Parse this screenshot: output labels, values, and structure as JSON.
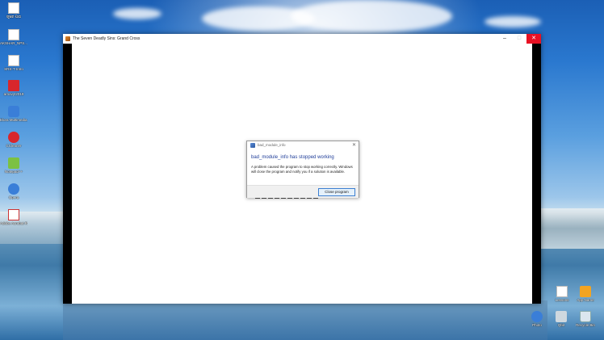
{
  "window": {
    "title": "The Seven Deadly Sins: Grand Cross",
    "minimize_glyph": "–",
    "maximize_glyph": "□",
    "close_glyph": "✕"
  },
  "dialog": {
    "title": "bad_module_info",
    "heading": "bad_module_info has stopped working",
    "body": "A problem caused the program to stop working correctly. Windows will close the program and notify you if a solution is available.",
    "button_label": "Close program",
    "close_glyph": "✕"
  },
  "desktop_icons_left": [
    {
      "name": "document-icon",
      "label": "ଙ୍ଗ୍ରେ ପାଠ"
    },
    {
      "name": "document-icon",
      "label": "AKSHAR_NPS..."
    },
    {
      "name": "document-icon",
      "label": "SRS-T-Intro"
    },
    {
      "name": "app-icon",
      "label": "arnavyt2019"
    },
    {
      "name": "app-icon",
      "label": "Elora Multimedia..."
    },
    {
      "name": "app-icon",
      "label": "CCleaner"
    },
    {
      "name": "app-icon",
      "label": "Notepad++"
    },
    {
      "name": "app-icon",
      "label": "Opera"
    },
    {
      "name": "pdf-icon",
      "label": "Adobe Acrobat Reader DC"
    }
  ],
  "desktop_icons_right": [
    {
      "name": "file-icon",
      "label": "Lessons"
    },
    {
      "name": "app-icon",
      "label": "App Name"
    },
    {
      "name": "sync-icon",
      "label": "Photo"
    },
    {
      "name": "drive-icon",
      "label": "Qbit"
    },
    {
      "name": "recycle-bin-icon",
      "label": "Recycle Bin"
    }
  ],
  "colors": {
    "dialog_heading": "#1f3d99",
    "close_button": "#e81123"
  }
}
